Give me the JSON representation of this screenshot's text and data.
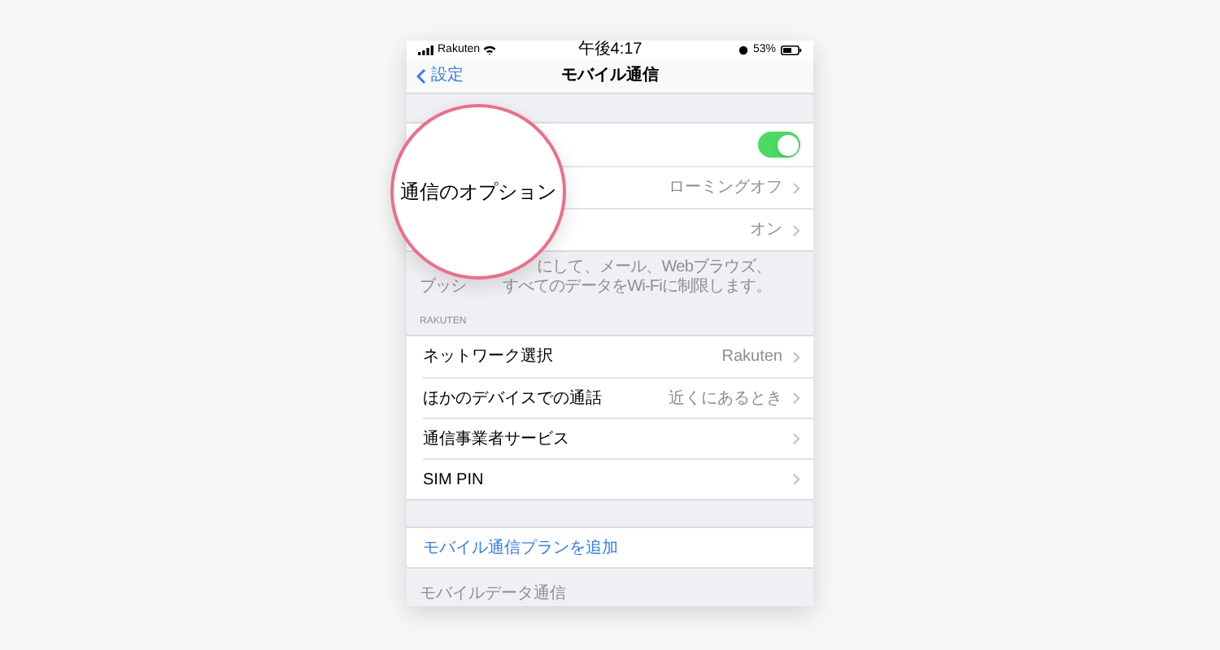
{
  "status_bar": {
    "carrier": "Rakuten",
    "time": "午後4:17",
    "battery": "53%"
  },
  "nav": {
    "back": "設定",
    "title": "モバイル通信"
  },
  "magnifier": {
    "text": "通信のオプション"
  },
  "top_rows": [
    {
      "kind": "toggle",
      "on": true
    },
    {
      "kind": "value",
      "value": "ローミングオフ"
    },
    {
      "kind": "value",
      "value": "オン"
    }
  ],
  "footer_lines": [
    {
      "segments": [
        "にして、メール、Webブラウズ、"
      ]
    },
    {
      "segments": [
        "ブッシ",
        "すべてのデータをWi-Fiに制限します。"
      ]
    }
  ],
  "section_header": "RAKUTEN",
  "carrier_rows": [
    {
      "label": "ネットワーク選択",
      "value": "Rakuten"
    },
    {
      "label": "ほかのデバイスでの通話",
      "value": "近くにあるとき"
    },
    {
      "label": "通信事業者サービス"
    },
    {
      "label": "SIM PIN"
    }
  ],
  "add_plan": "モバイル通信プランを追加",
  "bottom_header": "モバイルデータ通信"
}
